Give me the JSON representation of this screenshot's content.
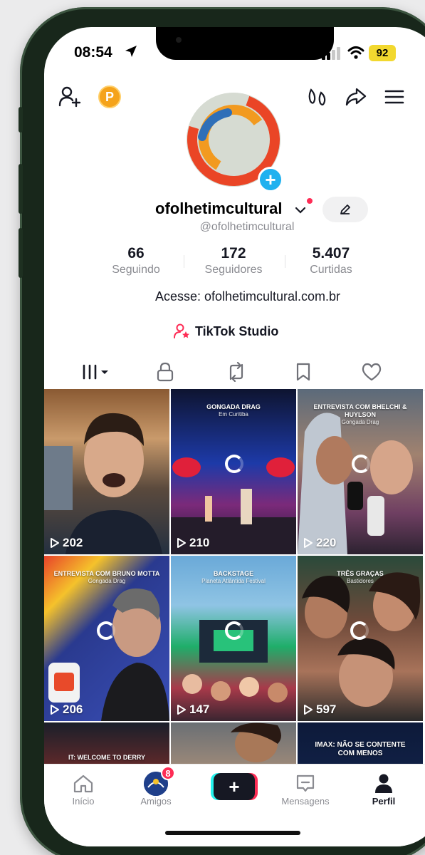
{
  "status": {
    "time": "08:54",
    "battery": "92"
  },
  "profile": {
    "username": "ofolhetimcultural",
    "handle": "@ofolhetimcultural",
    "bio": "Acesse: ofolhetimcultural.com.br",
    "studio_label": "TikTok Studio",
    "coin_letter": "P"
  },
  "stats": [
    {
      "value": "66",
      "label": "Seguindo"
    },
    {
      "value": "172",
      "label": "Seguidores"
    },
    {
      "value": "5.407",
      "label": "Curtidas"
    }
  ],
  "videos": [
    {
      "views": "202",
      "title": "",
      "subtitle": ""
    },
    {
      "views": "210",
      "title": "GONGADA DRAG",
      "subtitle": "Em Curitiba"
    },
    {
      "views": "220",
      "title": "ENTREVISTA COM BHELCHI & HUYLSON",
      "subtitle": "Gongada Drag"
    },
    {
      "views": "206",
      "title": "ENTREVISTA COM BRUNO MOTTA",
      "subtitle": "Gongada Drag"
    },
    {
      "views": "147",
      "title": "BACKSTAGE",
      "subtitle": "Planeta Atlântida Festival"
    },
    {
      "views": "597",
      "title": "TRÊS GRAÇAS",
      "subtitle": "Bastidores"
    },
    {
      "views": "",
      "title": "IT: WELCOME TO DERRY",
      "subtitle": ""
    },
    {
      "views": "",
      "title": "",
      "subtitle": ""
    },
    {
      "views": "",
      "title": "IMAX: NÃO SE CONTENTE COM MENOS",
      "subtitle": ""
    }
  ],
  "nav": {
    "home": "Início",
    "friends": "Amigos",
    "friends_badge": "8",
    "create": "+",
    "messages": "Mensagens",
    "profile": "Perfil"
  }
}
